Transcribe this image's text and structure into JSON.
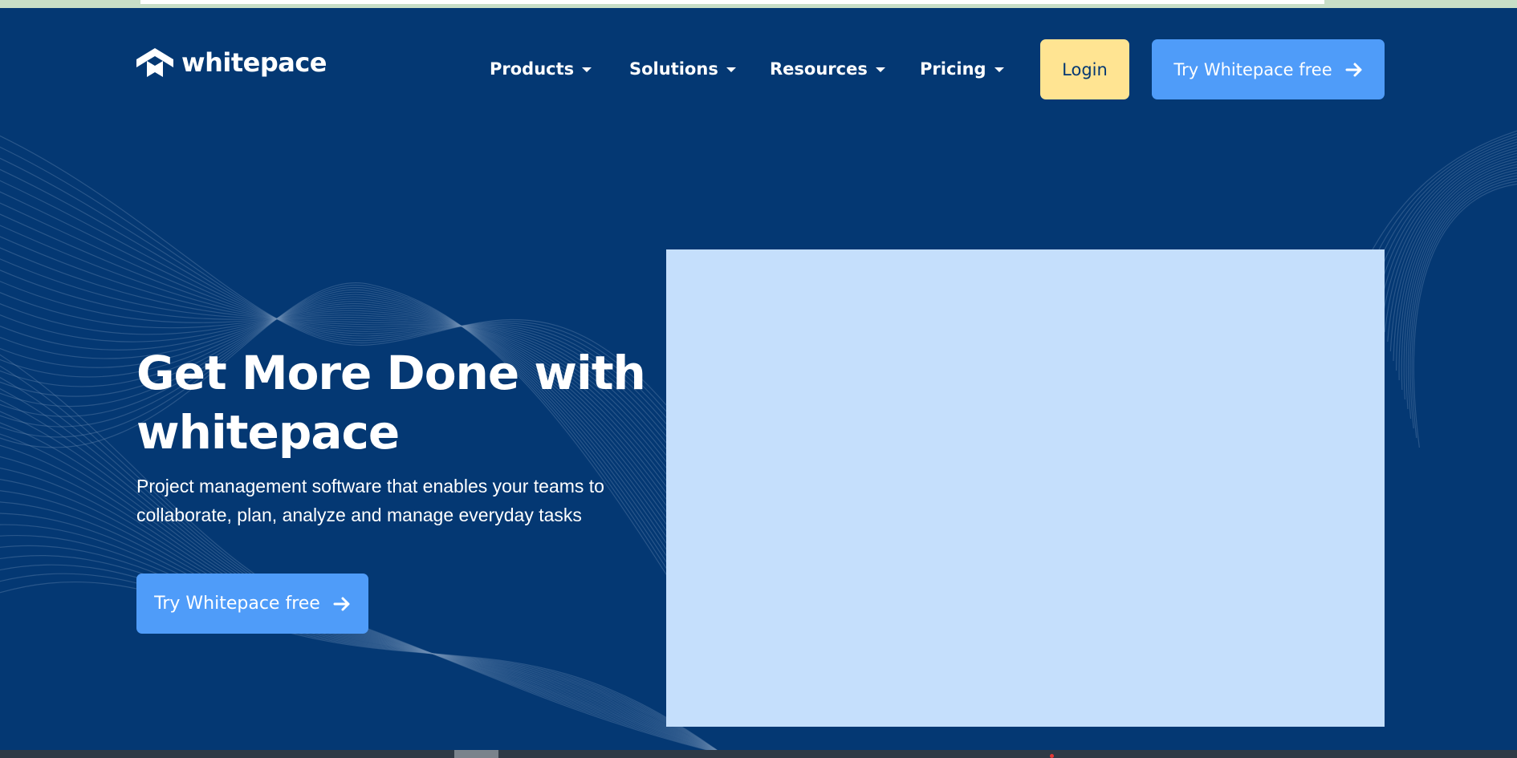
{
  "brand": {
    "name": "whitepace",
    "logo_icon": "whitepace-logo-icon"
  },
  "nav": {
    "items": [
      {
        "label": "Products",
        "icon": "caret-down-icon"
      },
      {
        "label": "Solutions",
        "icon": "caret-down-icon"
      },
      {
        "label": "Resources",
        "icon": "caret-down-icon"
      },
      {
        "label": "Pricing",
        "icon": "caret-down-icon"
      }
    ],
    "login_label": "Login",
    "try_label": "Try Whitepace free",
    "try_icon": "arrow-right-icon"
  },
  "hero": {
    "title": "Get More Done with whitepace",
    "subtitle": "Project management software that enables your teams to collaborate, plan, analyze and manage everyday tasks",
    "cta_label": "Try Whitepace free",
    "cta_icon": "arrow-right-icon"
  },
  "colors": {
    "background": "#043873",
    "login_button": "#ffe492",
    "primary_button": "#4f9cf9",
    "image_placeholder": "#c5dffc"
  }
}
